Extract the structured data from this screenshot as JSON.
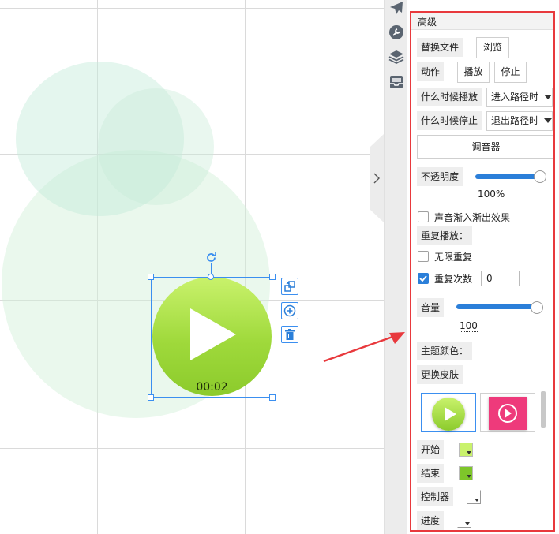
{
  "canvas": {
    "play_widget": {
      "time": "00:02",
      "color_start": "#c9f26c",
      "color_end": "#8ccb2c"
    }
  },
  "toolbar": {
    "icons": [
      "airplane-icon",
      "wrench-icon",
      "layers-icon",
      "inbox-icon"
    ]
  },
  "panel": {
    "title": "高级",
    "replace_file": {
      "label": "替换文件",
      "browse": "浏览"
    },
    "action": {
      "label": "动作",
      "play": "播放",
      "stop": "停止"
    },
    "when_play": {
      "label": "什么时候播放",
      "value": "进入路径时"
    },
    "when_stop": {
      "label": "什么时候停止",
      "value": "退出路径时"
    },
    "mixer_button": "调音器",
    "opacity": {
      "label": "不透明度",
      "value": "100%",
      "level": 100
    },
    "fade_effect": {
      "label": "声音渐入渐出效果",
      "checked": false
    },
    "repeat_play_label": "重复播放：",
    "infinite_repeat": {
      "label": "无限重复",
      "checked": false
    },
    "repeat_count": {
      "label": "重复次数",
      "checked": true,
      "value": "0"
    },
    "volume": {
      "label": "音量",
      "value": "100",
      "level": 100
    },
    "theme_color_label": "主题颜色：",
    "change_skin_label": "更换皮肤",
    "skins": [
      {
        "name": "green",
        "color": "#9fd93b"
      },
      {
        "name": "pink",
        "color": "#ee3a7b"
      }
    ],
    "start": {
      "label": "开始",
      "color": "#c9f26c"
    },
    "end": {
      "label": "结束",
      "color": "#7ec62a"
    },
    "controller": {
      "label": "控制器",
      "color": "#ffffff"
    },
    "progress": {
      "label": "进度",
      "color": "#ffffff"
    }
  },
  "colors": {
    "accent": "#2b7fd9",
    "highlight_border": "#e8393d",
    "selection": "#3b8ff0"
  }
}
